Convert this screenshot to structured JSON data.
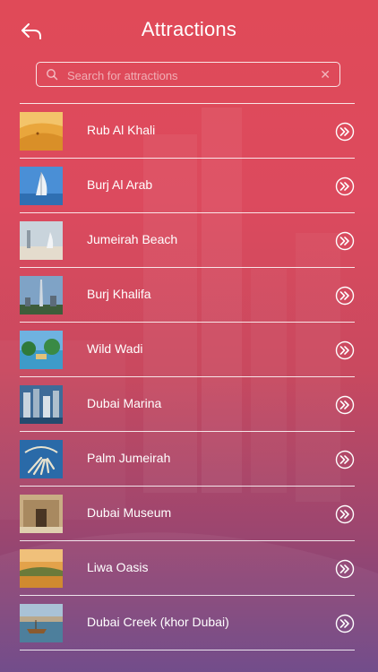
{
  "header": {
    "title": "Attractions",
    "back_icon": "back-arrow-icon"
  },
  "search": {
    "placeholder": "Search for attractions",
    "value": ""
  },
  "attractions": [
    {
      "label": "Rub Al Khali",
      "thumb": "desert"
    },
    {
      "label": "Burj Al Arab",
      "thumb": "sail-tower"
    },
    {
      "label": "Jumeirah Beach",
      "thumb": "beach"
    },
    {
      "label": "Burj Khalifa",
      "thumb": "skyscraper"
    },
    {
      "label": "Wild Wadi",
      "thumb": "waterpark"
    },
    {
      "label": "Dubai Marina",
      "thumb": "marina"
    },
    {
      "label": "Palm Jumeirah",
      "thumb": "palm-island"
    },
    {
      "label": "Dubai Museum",
      "thumb": "museum"
    },
    {
      "label": "Liwa Oasis",
      "thumb": "oasis"
    },
    {
      "label": "Dubai Creek (khor Dubai)",
      "thumb": "creek"
    }
  ],
  "colors": {
    "gradient_top": "#e04a58",
    "gradient_bottom": "#6b4485",
    "foreground": "#ffffff"
  }
}
